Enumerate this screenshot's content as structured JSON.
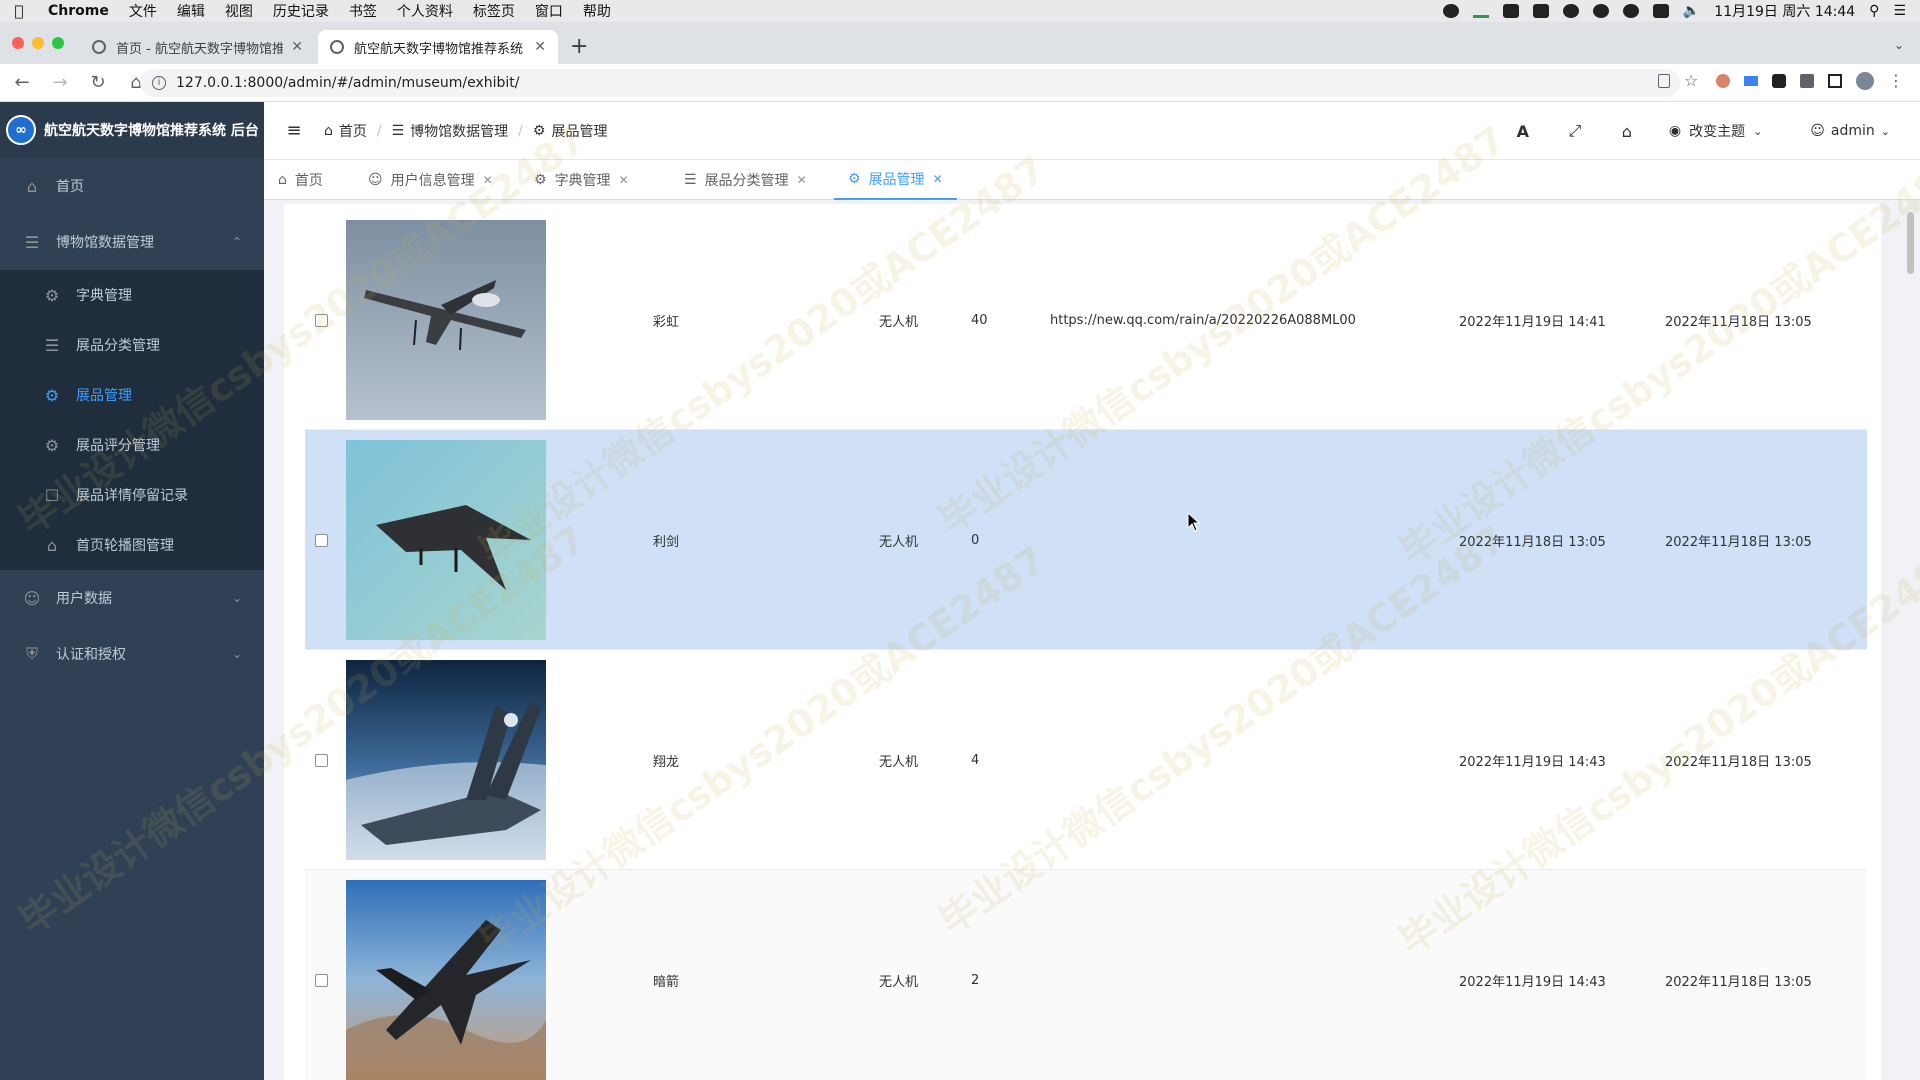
{
  "menubar": {
    "app": "Chrome",
    "items": [
      "文件",
      "编辑",
      "视图",
      "历史记录",
      "书签",
      "个人资料",
      "标签页",
      "窗口",
      "帮助"
    ],
    "datetime": "11月19日 周六 14:44"
  },
  "browser": {
    "tabs": [
      {
        "title": "首页 - 航空航天数字博物馆推荐系"
      },
      {
        "title": "航空航天数字博物馆推荐系统 后"
      }
    ],
    "url": "127.0.0.1:8000/admin/#/admin/museum/exhibit/"
  },
  "sidebar": {
    "brand": "航空航天数字博物馆推荐系统 后台",
    "home": "首页",
    "group": "博物馆数据管理",
    "subitems": [
      "字典管理",
      "展品分类管理",
      "展品管理",
      "展品评分管理",
      "展品详情停留记录",
      "首页轮播图管理"
    ],
    "user_data": "用户数据",
    "auth": "认证和授权"
  },
  "header": {
    "breadcrumb": [
      "首页",
      "博物馆数据管理",
      "展品管理"
    ],
    "theme": "改变主题",
    "user": "admin"
  },
  "tags": [
    "首页",
    "用户信息管理",
    "字典管理",
    "展品分类管理",
    "展品管理"
  ],
  "table": {
    "rows": [
      {
        "name": "彩虹",
        "category": "无人机",
        "views": "40",
        "link": "https://new.qq.com/rain/a/20220226A088ML00",
        "updated": "2022年11月19日 14:41",
        "created": "2022年11月18日 13:05"
      },
      {
        "name": "利剑",
        "category": "无人机",
        "views": "0",
        "link": "",
        "updated": "2022年11月18日 13:05",
        "created": "2022年11月18日 13:05"
      },
      {
        "name": "翔龙",
        "category": "无人机",
        "views": "4",
        "link": "",
        "updated": "2022年11月19日 14:43",
        "created": "2022年11月18日 13:05"
      },
      {
        "name": "暗箭",
        "category": "无人机",
        "views": "2",
        "link": "",
        "updated": "2022年11月19日 14:43",
        "created": "2022年11月18日 13:05"
      }
    ]
  },
  "colors": {
    "sidebar_bg": "#304156",
    "active": "#409eff",
    "row_hover": "#cfe0f7"
  },
  "watermark": "毕业设计微信csbys2020或ACE2487"
}
